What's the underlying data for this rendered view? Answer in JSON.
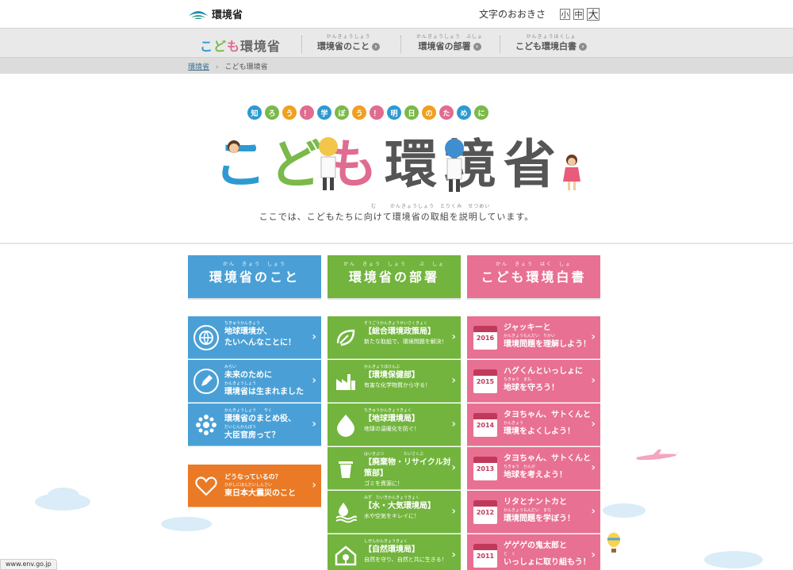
{
  "header": {
    "logo_text": "環境省",
    "fontsize_label": "文字のおおきさ",
    "fontsize_small": "小",
    "fontsize_mid": "中",
    "fontsize_large": "大"
  },
  "nav": {
    "home_chars": [
      "こ",
      "ど",
      "も",
      "環境省"
    ],
    "items": [
      {
        "ruby": "かんきょうしょう",
        "label": "環境省のこと"
      },
      {
        "ruby": "かんきょうしょう　ぶしょ",
        "label": "環境省の部署"
      },
      {
        "ruby": "かんきょうはくしょ",
        "label": "こども環境白書"
      }
    ]
  },
  "breadcrumb": {
    "home": "環境省",
    "sep": "›",
    "current": "こども環境省"
  },
  "hero": {
    "tagline": [
      "知",
      "ろ",
      "う",
      "！",
      "学",
      "ぼ",
      "う",
      "！",
      "明",
      "日",
      "の",
      "た",
      "め",
      "に"
    ],
    "tagline_colors": [
      "#2d9ad1",
      "#7ab94a",
      "#f0a020",
      "#e06c8f",
      "#2d9ad1",
      "#7ab94a",
      "#f0a020",
      "#e06c8f",
      "#2d9ad1",
      "#7ab94a",
      "#f0a020",
      "#e06c8f",
      "#2d9ad1",
      "#7ab94a"
    ],
    "title_chars": [
      "こ",
      "ど",
      "も",
      "環",
      "境",
      "省"
    ],
    "title_colors": [
      "#2d9ad1",
      "#7ab94a",
      "#e06c8f",
      "#555555",
      "#555555",
      "#555555"
    ],
    "subtitle": "ここでは、こどもたちに向けて環境省の取組を説明しています。",
    "sub_ruby_1": "む",
    "sub_ruby_2": "かんきょうしょう　とりくみ　せつめい"
  },
  "columns": [
    {
      "ruby": "かん　きょう　しょう",
      "label": "環境省のこと",
      "color": "#4aa0d6"
    },
    {
      "ruby": "かん　きょう　しょう　　ぶ　しょ",
      "label": "環境省の部署",
      "color": "#72b43d"
    },
    {
      "ruby": "かん　きょう　はく　しょ",
      "label": "こども環境白書",
      "color": "#e87092"
    }
  ],
  "col1_cards": [
    {
      "ruby": "ちきゅうかんきょう",
      "line1": "地球環境が、",
      "line2": "たいへんなことに！",
      "icon": "globe-icon"
    },
    {
      "ruby": "みらい",
      "line1": "未来のために",
      "ruby2": "かんきょうしょう",
      "line2": "環境省は生まれました",
      "icon": "pencil-icon"
    },
    {
      "ruby": "かんきょうしょう　　やく",
      "line1": "環境省のまとめ役、",
      "ruby2": "だいじんかんぼう",
      "line2": "大臣官房って？",
      "icon": "people-icon"
    }
  ],
  "col1_special": {
    "line1": "どうなっているの？",
    "ruby": "ひがしにほんだいしんさい",
    "line2": "東日本大震災のこと",
    "icon": "heart-hands-icon"
  },
  "col2_cards": [
    {
      "ruby": "そうごうかんきょうせいさくきょく",
      "title": "【総合環境政策局】",
      "note": "新たな取組で、環境問題を解決！",
      "icon": "leaf-icon"
    },
    {
      "ruby": "かんきょうほけんぶ",
      "title": "【環境保健部】",
      "note": "有害な化学物質から守る！",
      "icon": "factory-icon"
    },
    {
      "ruby": "ちきゅうかんきょうきょく",
      "title": "【地球環境局】",
      "note": "地球の温暖化を防ぐ！",
      "icon": "earth-drop-icon"
    },
    {
      "ruby": "はいきぶつ　　　　　たいさくぶ",
      "title": "【廃棄物・リサイクル対策部】",
      "note": "ゴミを資源に！",
      "icon": "trash-icon"
    },
    {
      "ruby": "みず　たいきかんきょうきょく",
      "title": "【水・大気環境局】",
      "note": "水や空気をキレイに！",
      "icon": "water-icon"
    },
    {
      "ruby": "しぜんかんきょうきょく",
      "title": "【自然環境局】",
      "note": "自然を守り、自然と共に生きる！",
      "icon": "house-tree-icon"
    }
  ],
  "col3_cards": [
    {
      "year": "2016",
      "line1": "ジャッキーと",
      "ruby": "かんきょうもんだい　りかい",
      "line2": "環境問題を理解しよう！"
    },
    {
      "year": "2015",
      "line1": "ハグくんといっしょに",
      "ruby": "ちきゅう　まも",
      "line2": "地球を守ろう！"
    },
    {
      "year": "2014",
      "line1": "タヨちゃん、サトくんと",
      "ruby": "かんきょう",
      "line2": "環境をよくしよう！"
    },
    {
      "year": "2013",
      "line1": "タヨちゃん、サトくんと",
      "ruby": "ちきゅう　かんが",
      "line2": "地球を考えよう！"
    },
    {
      "year": "2012",
      "line1": "リタとナントカと",
      "ruby": "かんきょうもんだい　まな",
      "line2": "環境問題を学ぼう！"
    },
    {
      "year": "2011",
      "line1": "ゲゲゲの鬼太郎と",
      "ruby": "と　く",
      "line2": "いっしょに取り組もう！"
    }
  ],
  "status_url": "www.env.go.jp"
}
